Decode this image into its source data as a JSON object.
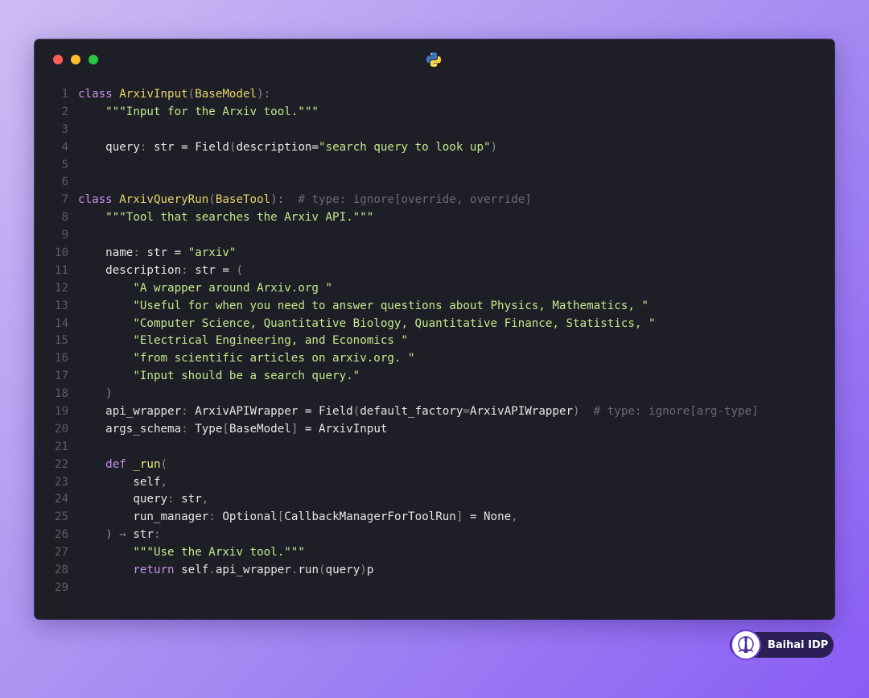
{
  "window": {
    "controls": [
      "close",
      "minimize",
      "maximize"
    ],
    "language_icon": "python-icon"
  },
  "code": {
    "lines": [
      {
        "n": "1",
        "t": [
          [
            "kw",
            "class "
          ],
          [
            "cls",
            "ArxivInput"
          ],
          [
            "pn",
            "("
          ],
          [
            "cls",
            "BaseModel"
          ],
          [
            "pn",
            "):"
          ]
        ]
      },
      {
        "n": "2",
        "t": [
          [
            "",
            "    "
          ],
          [
            "str",
            "\"\"\"Input for the Arxiv tool.\"\"\""
          ]
        ]
      },
      {
        "n": "3",
        "t": []
      },
      {
        "n": "4",
        "t": [
          [
            "",
            "    query"
          ],
          [
            "pn",
            ": "
          ],
          [
            "",
            "str = Field"
          ],
          [
            "pn",
            "("
          ],
          [
            "",
            "description="
          ],
          [
            "str",
            "\"search query to look up\""
          ],
          [
            "pn",
            ")"
          ]
        ]
      },
      {
        "n": "5",
        "t": []
      },
      {
        "n": "6",
        "t": []
      },
      {
        "n": "7",
        "t": [
          [
            "kw",
            "class "
          ],
          [
            "cls",
            "ArxivQueryRun"
          ],
          [
            "pn",
            "("
          ],
          [
            "cls",
            "BaseTool"
          ],
          [
            "pn",
            "):"
          ],
          [
            "cmt",
            "  # type: ignore[override, override]"
          ]
        ]
      },
      {
        "n": "8",
        "t": [
          [
            "",
            "    "
          ],
          [
            "str",
            "\"\"\"Tool that searches the Arxiv API.\"\"\""
          ]
        ]
      },
      {
        "n": "9",
        "t": []
      },
      {
        "n": "10",
        "t": [
          [
            "",
            "    name"
          ],
          [
            "pn",
            ": "
          ],
          [
            "",
            "str = "
          ],
          [
            "str",
            "\"arxiv\""
          ]
        ]
      },
      {
        "n": "11",
        "t": [
          [
            "",
            "    description"
          ],
          [
            "pn",
            ": "
          ],
          [
            "",
            "str = "
          ],
          [
            "pn",
            "("
          ]
        ]
      },
      {
        "n": "12",
        "t": [
          [
            "",
            "        "
          ],
          [
            "str",
            "\"A wrapper around Arxiv.org \""
          ]
        ]
      },
      {
        "n": "13",
        "t": [
          [
            "",
            "        "
          ],
          [
            "str",
            "\"Useful for when you need to answer questions about Physics, Mathematics, \""
          ]
        ]
      },
      {
        "n": "14",
        "t": [
          [
            "",
            "        "
          ],
          [
            "str",
            "\"Computer Science, Quantitative Biology, Quantitative Finance, Statistics, \""
          ]
        ]
      },
      {
        "n": "15",
        "t": [
          [
            "",
            "        "
          ],
          [
            "str",
            "\"Electrical Engineering, and Economics \""
          ]
        ]
      },
      {
        "n": "16",
        "t": [
          [
            "",
            "        "
          ],
          [
            "str",
            "\"from scientific articles on arxiv.org. \""
          ]
        ]
      },
      {
        "n": "17",
        "t": [
          [
            "",
            "        "
          ],
          [
            "str",
            "\"Input should be a search query.\""
          ]
        ]
      },
      {
        "n": "18",
        "t": [
          [
            "",
            "    "
          ],
          [
            "pn",
            ")"
          ]
        ]
      },
      {
        "n": "19",
        "t": [
          [
            "",
            "    api_wrapper"
          ],
          [
            "pn",
            ": "
          ],
          [
            "",
            "ArxivAPIWrapper = Field"
          ],
          [
            "pn",
            "("
          ],
          [
            "",
            "default_factory"
          ],
          [
            "pn",
            "="
          ],
          [
            "",
            "ArxivAPIWrapper"
          ],
          [
            "pn",
            ")"
          ],
          [
            "cmt",
            "  # type: ignore[arg-type]"
          ]
        ]
      },
      {
        "n": "20",
        "t": [
          [
            "",
            "    args_schema"
          ],
          [
            "pn",
            ": "
          ],
          [
            "",
            "Type"
          ],
          [
            "pn",
            "["
          ],
          [
            "",
            "BaseModel"
          ],
          [
            "pn",
            "]"
          ],
          [
            "",
            " = ArxivInput"
          ]
        ]
      },
      {
        "n": "21",
        "t": []
      },
      {
        "n": "22",
        "t": [
          [
            "",
            "    "
          ],
          [
            "kw",
            "def "
          ],
          [
            "fn",
            "_run"
          ],
          [
            "pn",
            "("
          ]
        ]
      },
      {
        "n": "23",
        "t": [
          [
            "",
            "        self"
          ],
          [
            "pn",
            ","
          ]
        ]
      },
      {
        "n": "24",
        "t": [
          [
            "",
            "        query"
          ],
          [
            "pn",
            ": "
          ],
          [
            "",
            "str"
          ],
          [
            "pn",
            ","
          ]
        ]
      },
      {
        "n": "25",
        "t": [
          [
            "",
            "        run_manager"
          ],
          [
            "pn",
            ": "
          ],
          [
            "",
            "Optional"
          ],
          [
            "pn",
            "["
          ],
          [
            "",
            "CallbackManagerForToolRun"
          ],
          [
            "pn",
            "]"
          ],
          [
            "",
            " = None"
          ],
          [
            "pn",
            ","
          ]
        ]
      },
      {
        "n": "26",
        "t": [
          [
            "",
            "    "
          ],
          [
            "pn",
            ") → "
          ],
          [
            "",
            "str"
          ],
          [
            "pn",
            ":"
          ]
        ]
      },
      {
        "n": "27",
        "t": [
          [
            "",
            "        "
          ],
          [
            "str",
            "\"\"\"Use the Arxiv tool.\"\"\""
          ]
        ]
      },
      {
        "n": "28",
        "t": [
          [
            "",
            "        "
          ],
          [
            "kw",
            "return "
          ],
          [
            "",
            "self"
          ],
          [
            "pn",
            "."
          ],
          [
            "",
            "api_wrapper"
          ],
          [
            "pn",
            "."
          ],
          [
            "",
            "run"
          ],
          [
            "pn",
            "("
          ],
          [
            "",
            "query"
          ],
          [
            "pn",
            ")"
          ],
          [
            "",
            "p"
          ]
        ]
      },
      {
        "n": "29",
        "t": []
      }
    ]
  },
  "badge": {
    "label": "Baihai IDP",
    "icon": "lighthouse-logo-icon"
  }
}
